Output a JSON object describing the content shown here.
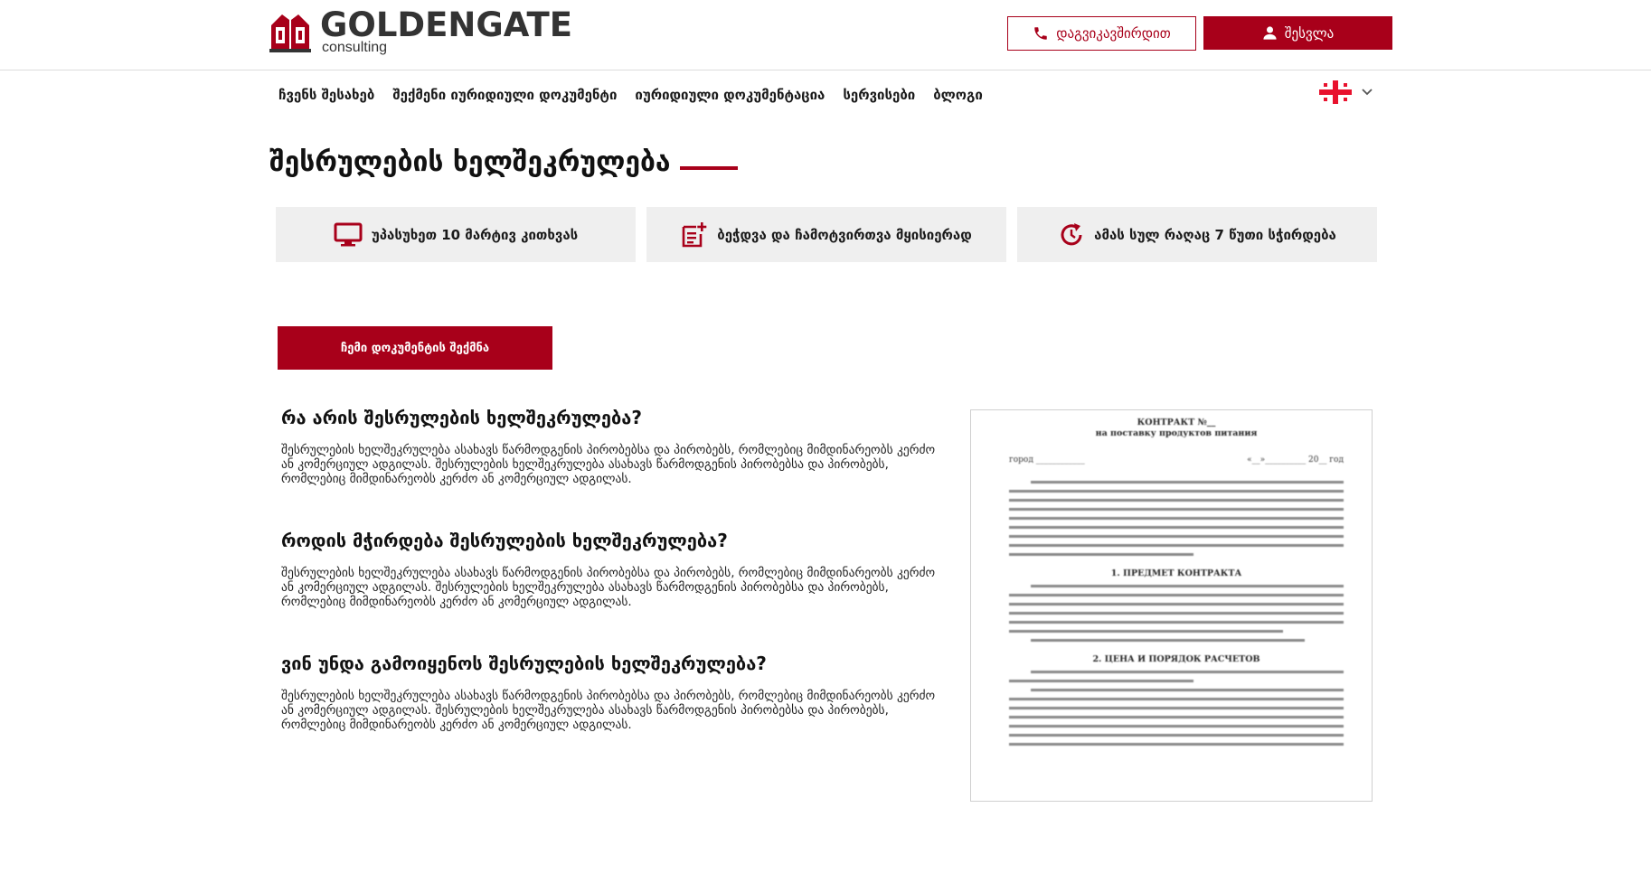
{
  "brand": {
    "name": "GOLDENGATE",
    "sub": "consulting",
    "accent": "#a8001a"
  },
  "header": {
    "call_label": "დაგვიკავშირდით",
    "login_label": "შესვლა"
  },
  "nav": {
    "items": [
      "ჩვენს შესახებ",
      "შექმენი იურიდიული დოკუმენტი",
      "იურიდიული დოკუმენტაცია",
      "სერვისები",
      "ბლოგი"
    ],
    "language_icon": "georgia-flag-icon"
  },
  "page": {
    "title": "შესრულების ხელშეკრულება"
  },
  "features": [
    {
      "icon": "monitor-icon",
      "text": "უპასუხეთ 10 მარტივ კითხვას"
    },
    {
      "icon": "document-add-icon",
      "text": "ბეჭდვა და ჩამოტვირთვა მყისიერად"
    },
    {
      "icon": "refresh-icon",
      "text": "ამას სულ რაღაც 7 წუთი სჭირდება"
    }
  ],
  "cta": {
    "label": "ჩემი დოკუმენტის შექმნა"
  },
  "faq": [
    {
      "question": "რა არის შესრულების ხელშეკრულება?",
      "answer": "შესრულების ხელშეკრულება ასახავს წარმოდგენის პირობებსა და პირობებს, რომლებიც მიმდინარეობს კერძო ან კომერციულ ადგილას. შესრულების ხელშეკრულება ასახავს წარმოდგენის პირობებსა და პირობებს, რომლებიც მიმდინარეობს კერძო ან კომერციულ ადგილას."
    },
    {
      "question": "როდის მჭირდება შესრულების ხელშეკრულება?",
      "answer": "შესრულების ხელშეკრულება ასახავს წარმოდგენის პირობებსა და პირობებს, რომლებიც მიმდინარეობს კერძო ან კომერციულ ადგილას. შესრულების ხელშეკრულება ასახავს წარმოდგენის პირობებსა და პირობებს, რომლებიც მიმდინარეობს კერძო ან კომერციულ ადგილას."
    },
    {
      "question": "ვინ უნდა გამოიყენოს შესრულების ხელშეკრულება?",
      "answer": "შესრულების ხელშეკრულება ასახავს წარმოდგენის პირობებსა და პირობებს, რომლებიც მიმდინარეობს კერძო ან კომერციულ ადგილას. შესრულების ხელშეკრულება ასახავს წარმოდგენის პირობებსა და პირობებს, რომლებიც მიმდინარეობს კერძო ან კომერციულ ადგილას."
    }
  ],
  "document_preview": {
    "heading": "КОНТРАКТ №__",
    "subheading": "на поставку продуктов питания",
    "city_label": "город ____________",
    "date_label": "«__»__________ 20__ год",
    "section1": "1. ПРЕДМЕТ КОНТРАКТА",
    "section2": "2. ЦЕНА И ПОРЯДОК РАСЧЕТОВ"
  }
}
